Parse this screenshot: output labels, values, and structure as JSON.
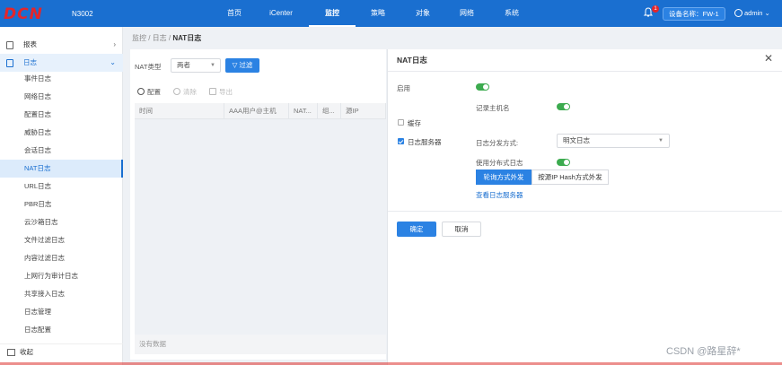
{
  "header": {
    "logo": "DCN",
    "model": "N3002",
    "nav": [
      {
        "label": "首页",
        "active": false,
        "width": 42
      },
      {
        "label": "iCenter",
        "active": false,
        "width": 62
      },
      {
        "label": "监控",
        "active": true,
        "width": 52
      },
      {
        "label": "策略",
        "active": false,
        "width": 50
      },
      {
        "label": "对象",
        "active": false,
        "width": 50
      },
      {
        "label": "网络",
        "active": false,
        "width": 48
      },
      {
        "label": "系统",
        "active": false,
        "width": 52
      }
    ],
    "bell_badge": "1",
    "device": "设备名称：FW-1",
    "user": "admin"
  },
  "sidebar": {
    "reports": "报表",
    "logs": "日志",
    "items": [
      "事件日志",
      "网络日志",
      "配置日志",
      "威胁日志",
      "会话日志",
      "NAT日志",
      "URL日志",
      "PBR日志",
      "云沙箱日志",
      "文件过滤日志",
      "内容过滤日志",
      "上网行为审计日志",
      "共享接入日志",
      "日志管理",
      "日志配置"
    ],
    "active_index": 5,
    "collapse": "收起"
  },
  "main": {
    "breadcrumb_prefix": "监控 / 日志 / ",
    "breadcrumb_current": "NAT日志",
    "filter_label": "NAT类型",
    "filter_value": "两者",
    "filter_btn": "过滤",
    "toolbar": {
      "config": "配置",
      "clear": "清除",
      "export": "导出"
    },
    "columns": [
      {
        "label": "时间",
        "width": 100
      },
      {
        "label": "AAA用户@主机",
        "width": 72
      },
      {
        "label": "NAT...",
        "width": 32
      },
      {
        "label": "组...",
        "width": 26
      },
      {
        "label": "源IP",
        "width": 50
      }
    ],
    "empty": "没有数据"
  },
  "modal": {
    "title": "NAT日志",
    "enable": "启用",
    "record_hostname": "记录主机名",
    "cache": "缓存",
    "log_server": "日志服务器",
    "dist_method": "日志分发方式:",
    "dist_value": "明文日志",
    "use_distributed": "使用分布式日志",
    "seg_round": "轮询方式外发",
    "seg_hash": "按源IP Hash方式外发",
    "view_servers": "查看日志服务器",
    "ok": "确定",
    "cancel": "取消"
  },
  "watermark": "CSDN @路星辞*"
}
